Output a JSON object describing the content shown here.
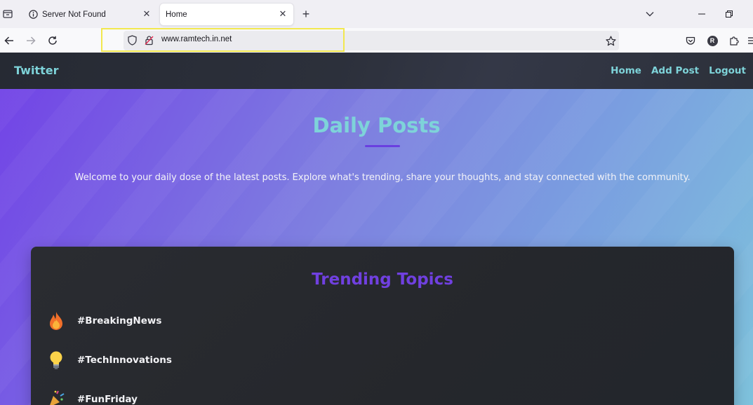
{
  "browser": {
    "tabs": [
      {
        "title": "Server Not Found",
        "active": false,
        "icon": "info-icon"
      },
      {
        "title": "Home",
        "active": true,
        "icon": "none"
      }
    ],
    "url": "www.ramtech.in.net",
    "profile_initial": "R",
    "highlight_color": "#f2e84e"
  },
  "site": {
    "brand": "Twitter",
    "nav": [
      {
        "label": "Home"
      },
      {
        "label": "Add Post"
      },
      {
        "label": "Logout"
      }
    ],
    "accent_color": "#7ed3d9"
  },
  "hero": {
    "title": "Daily Posts",
    "subtitle": "Welcome to your daily dose of the latest posts. Explore what's trending, share your thoughts, and stay connected with the community."
  },
  "trending": {
    "title": "Trending Topics",
    "title_color": "#7040e0",
    "topics": [
      {
        "icon": "fire-icon",
        "label": "#BreakingNews"
      },
      {
        "icon": "lightbulb-icon",
        "label": "#TechInnovations"
      },
      {
        "icon": "party-popper-icon",
        "label": "#FunFriday"
      }
    ]
  }
}
